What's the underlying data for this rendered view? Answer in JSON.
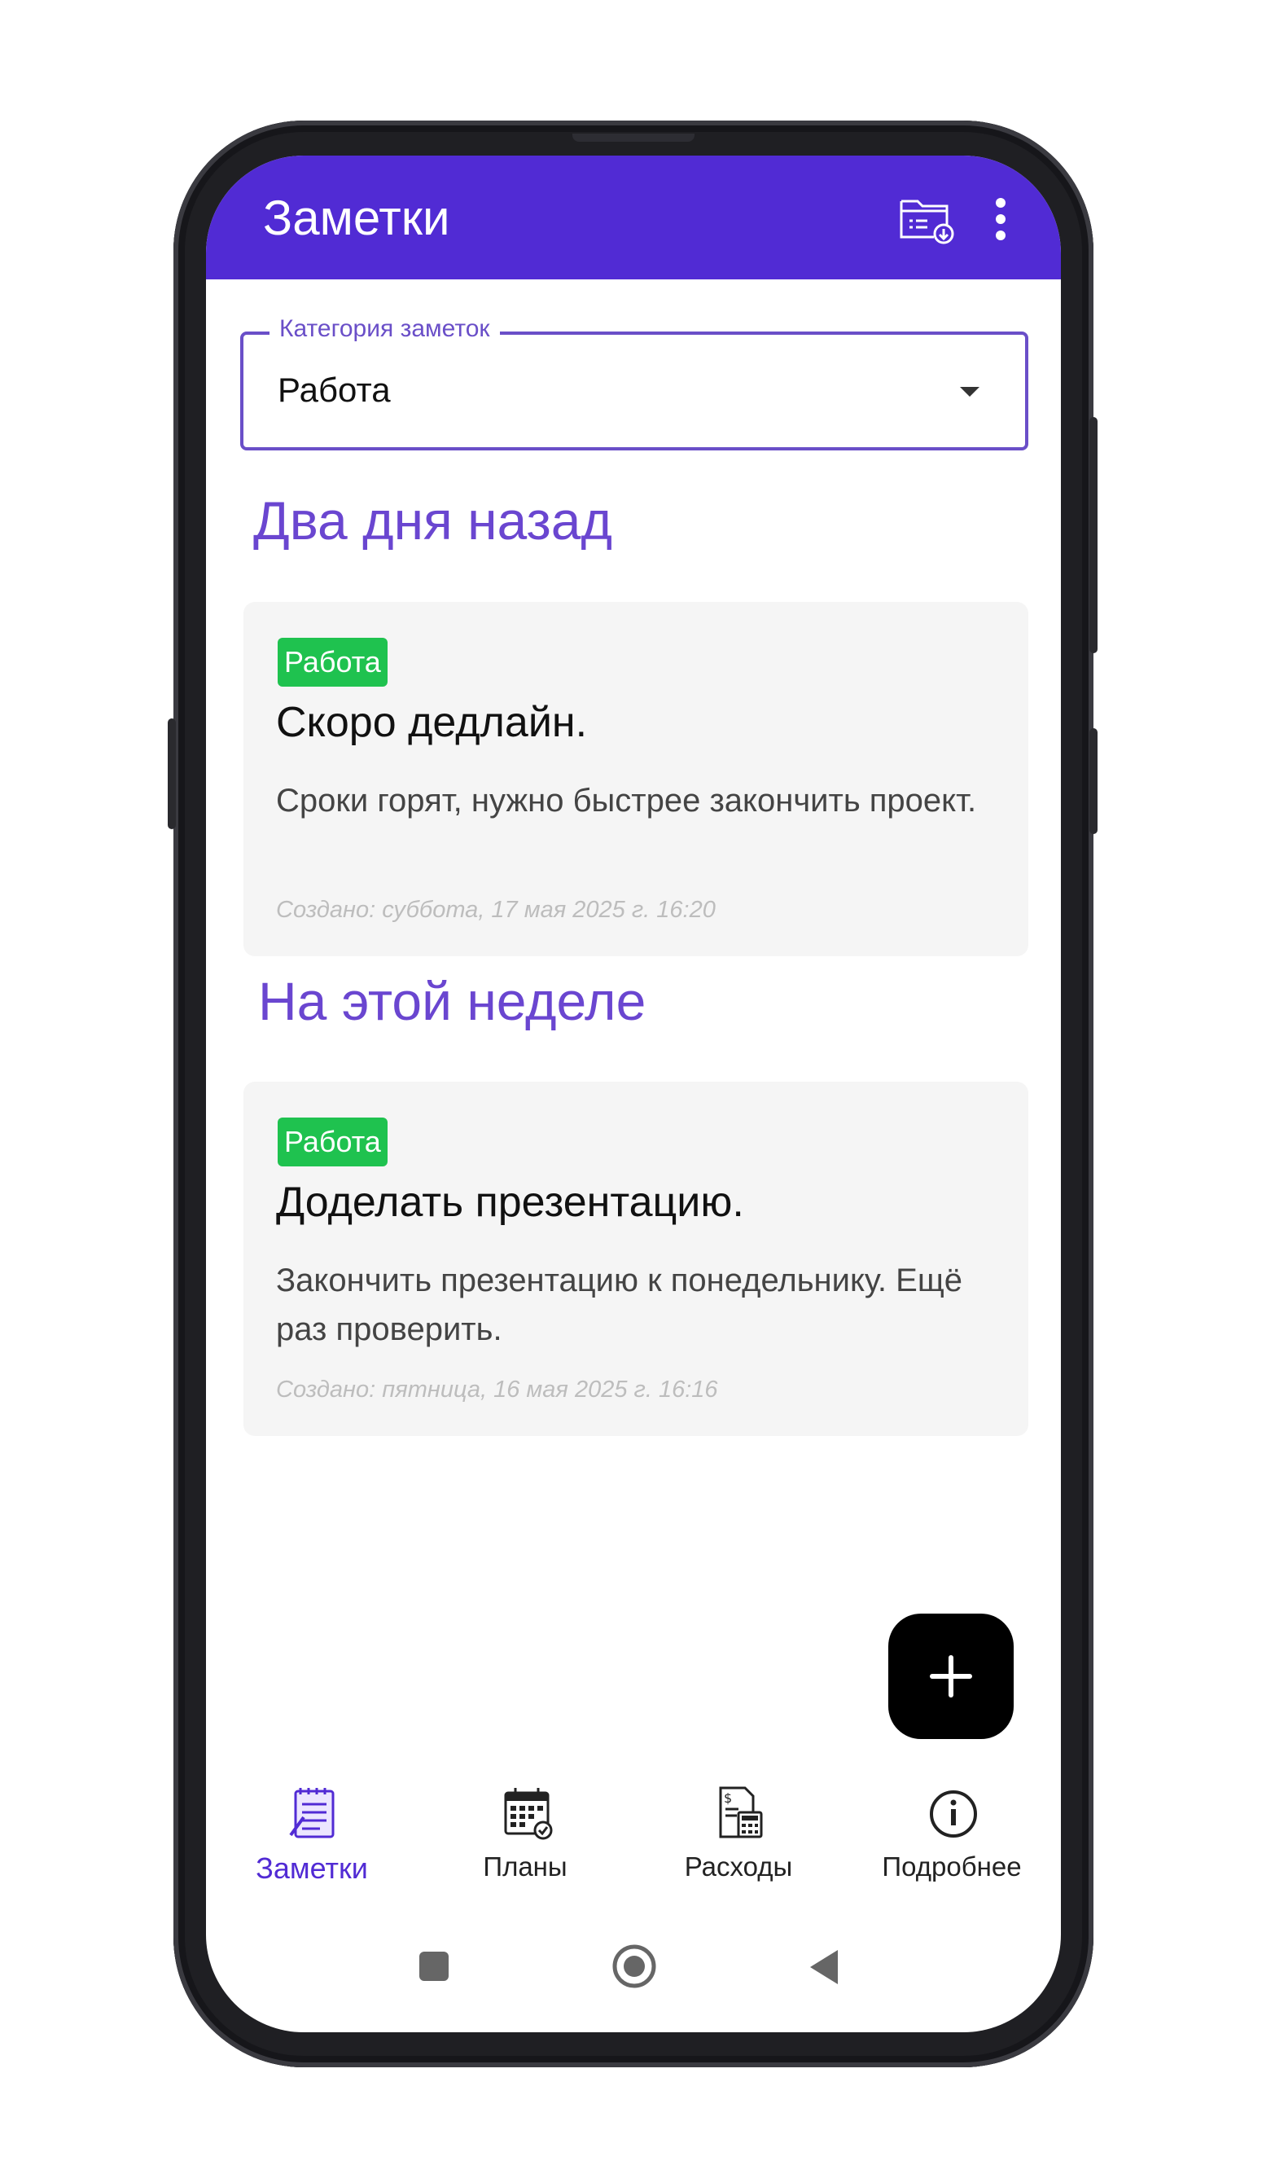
{
  "appbar": {
    "title": "Заметки",
    "icons": [
      "folder-download-icon",
      "more-vert-icon"
    ],
    "color": "#512bd4"
  },
  "category_picker": {
    "label": "Категория заметок",
    "value": "Работа"
  },
  "sections": [
    {
      "title": "Два дня назад",
      "notes": [
        {
          "tag": "Работа",
          "title": "Скоро дедлайн.",
          "body": "Сроки горят, нужно быстрее закончить проект.",
          "created": "Создано: суббота, 17 мая 2025 г. 16:20"
        }
      ]
    },
    {
      "title": "На этой неделе",
      "notes": [
        {
          "tag": "Работа",
          "title": "Доделать презентацию.",
          "body": "Закончить презентацию к понедельнику. Ещё раз проверить.",
          "created": "Создано: пятница, 16 мая 2025 г. 16:16"
        }
      ]
    }
  ],
  "fab": {
    "icon": "plus-icon"
  },
  "bottom_nav": [
    {
      "label": "Заметки",
      "icon": "notepad-icon",
      "active": true
    },
    {
      "label": "Планы",
      "icon": "calendar-icon",
      "active": false
    },
    {
      "label": "Расходы",
      "icon": "expenses-icon",
      "active": false
    },
    {
      "label": "Подробнее",
      "icon": "info-icon",
      "active": false
    }
  ],
  "system_nav": [
    "recents-icon",
    "home-icon",
    "back-icon"
  ],
  "colors": {
    "accent": "#512bd4",
    "section_title": "#6a46d0",
    "tag": "#1fc24f"
  }
}
